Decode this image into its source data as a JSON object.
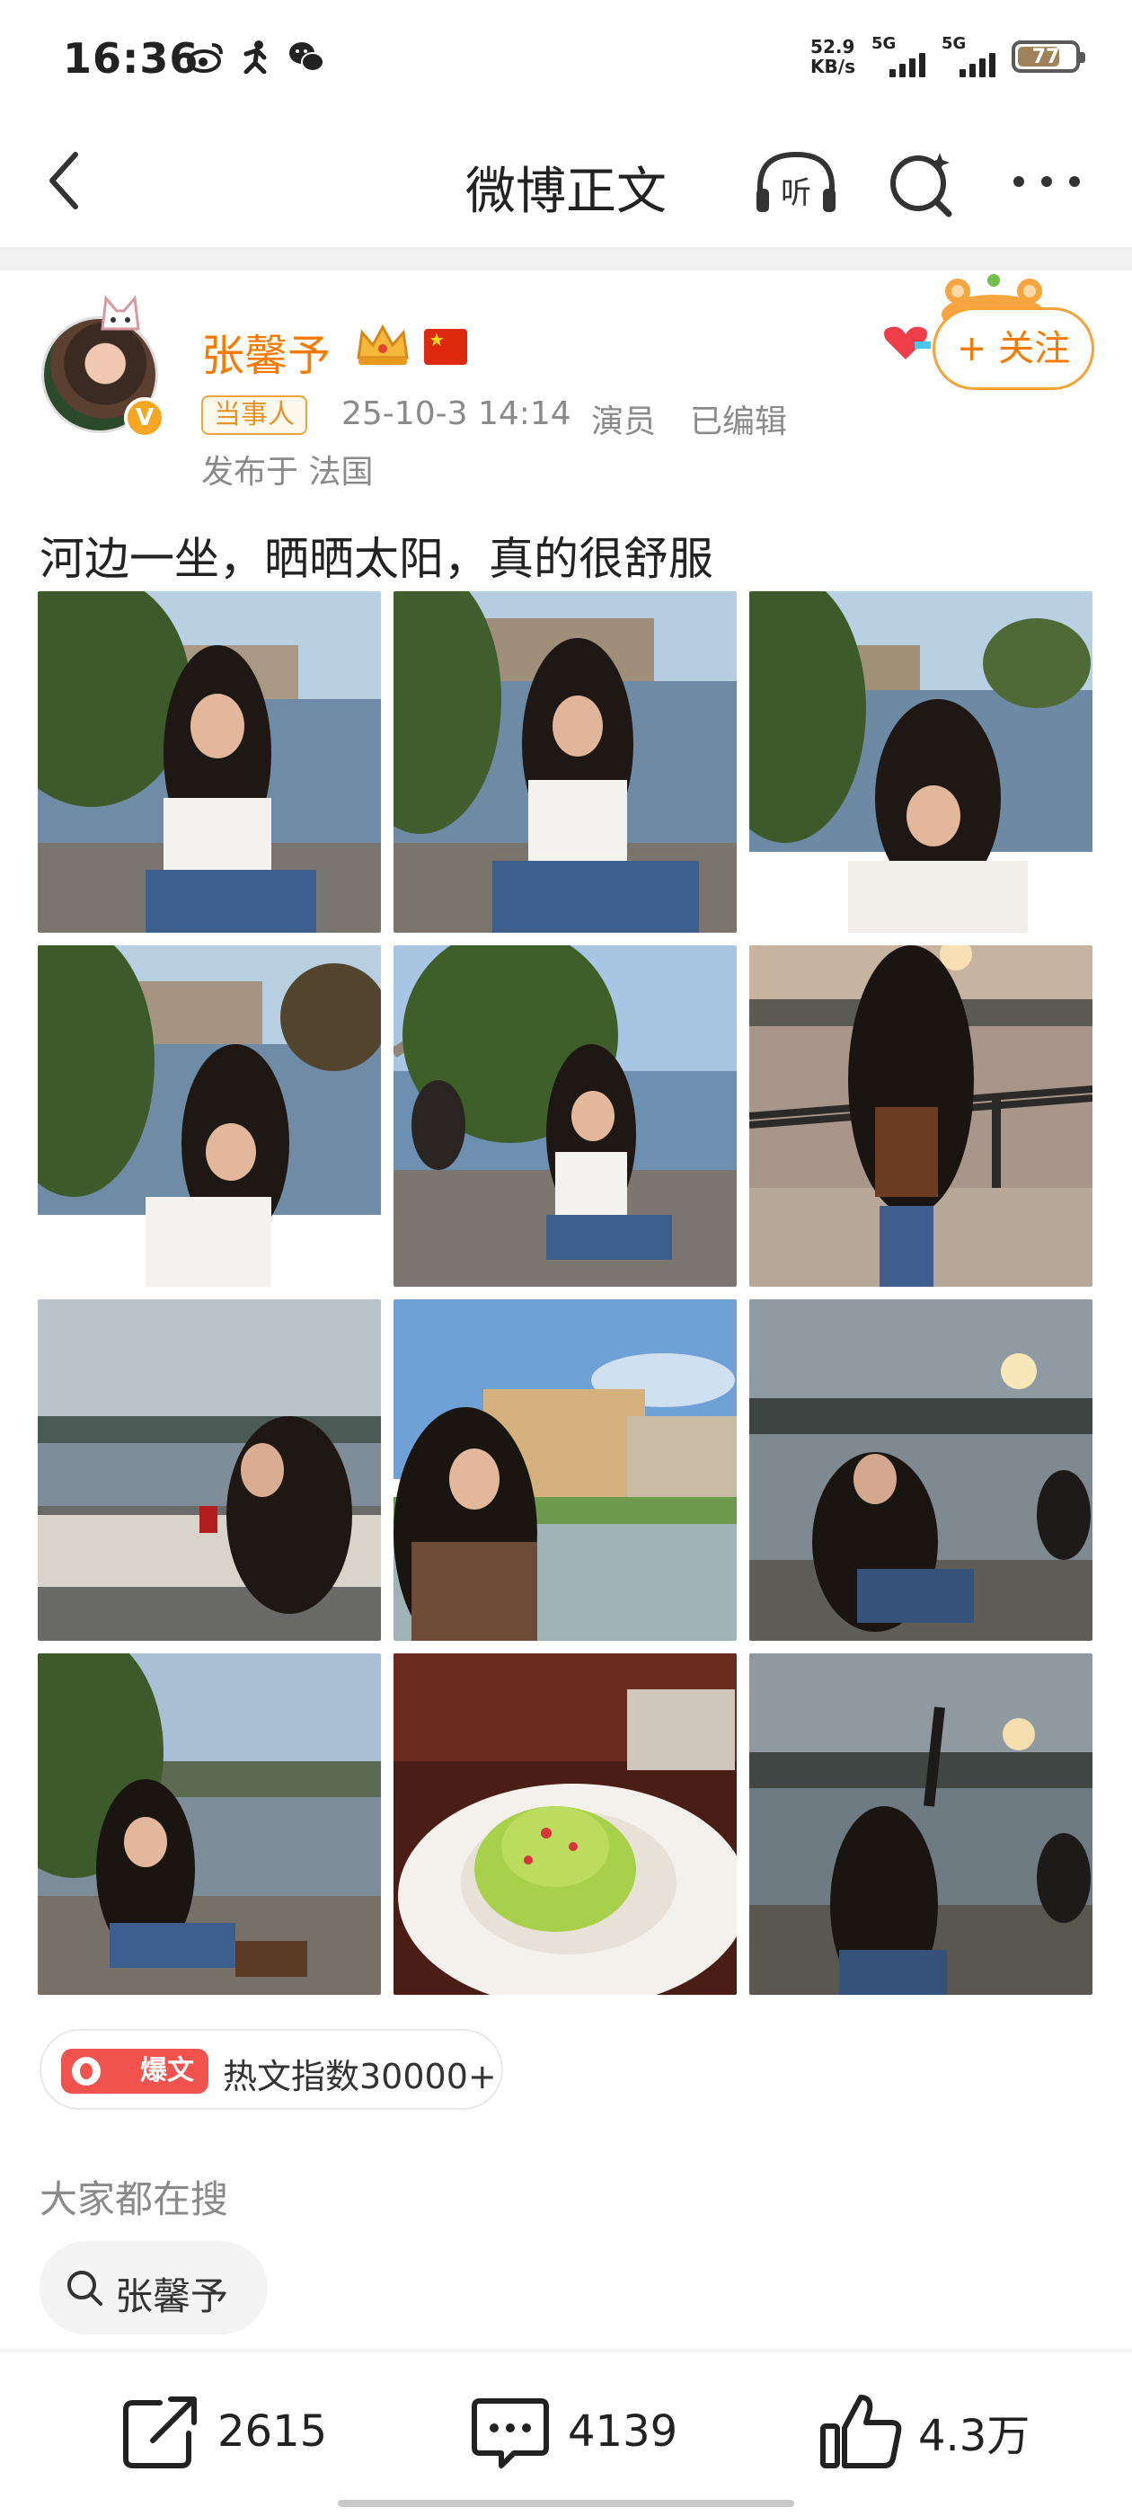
{
  "status_bar": {
    "time": "16:36",
    "net_speed_value": "52.9",
    "net_speed_unit": "KB/s",
    "sim1_label": "5G",
    "sim2_label": "5G",
    "battery_level": "77",
    "app_icons": [
      "weibo-icon",
      "walking-person-icon",
      "wechat-icon"
    ]
  },
  "nav": {
    "title": "微博正文",
    "listen_label": "听"
  },
  "post": {
    "author": "张馨予",
    "verified_mark": "V",
    "tag": "当事人",
    "date": "25-10-3 14:14",
    "role": "演员",
    "edited": "已编辑",
    "location": "发布于 法国",
    "follow_label": "+ 关注",
    "text": "河边一坐，晒晒太阳，真的很舒服",
    "photo_count": 12
  },
  "hot": {
    "badge": "爆文",
    "text": "热文指数30000+"
  },
  "search": {
    "heading": "大家都在搜",
    "chip": "张馨予"
  },
  "actions": {
    "repost_count": "2615",
    "comment_count": "4139",
    "like_count": "4.3万"
  },
  "colors": {
    "accent_orange": "#f77b00",
    "follow_border": "#f7a235",
    "hot_red": "#f0524d",
    "meta_gray": "#8a8a8a"
  }
}
